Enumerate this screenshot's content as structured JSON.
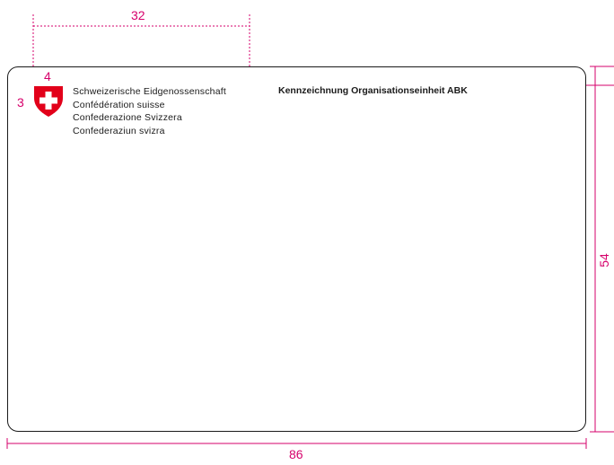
{
  "dimensions": {
    "width_label": "32",
    "card_width_label": "86",
    "card_height_label": "54",
    "top_margin_label": "4",
    "left_margin_label": "3"
  },
  "logo": {
    "lines": [
      "Schweizerische Eidgenossenschaft",
      "Confédération suisse",
      "Confederazione Svizzera",
      "Confederaziun svizra"
    ],
    "crest": "swiss-cross-icon"
  },
  "card": {
    "title": "Kennzeichnung Organisationseinheit ABK"
  },
  "colors": {
    "guide": "#d6006b",
    "shield": "#e2001a",
    "outline": "#1a1a1a"
  }
}
